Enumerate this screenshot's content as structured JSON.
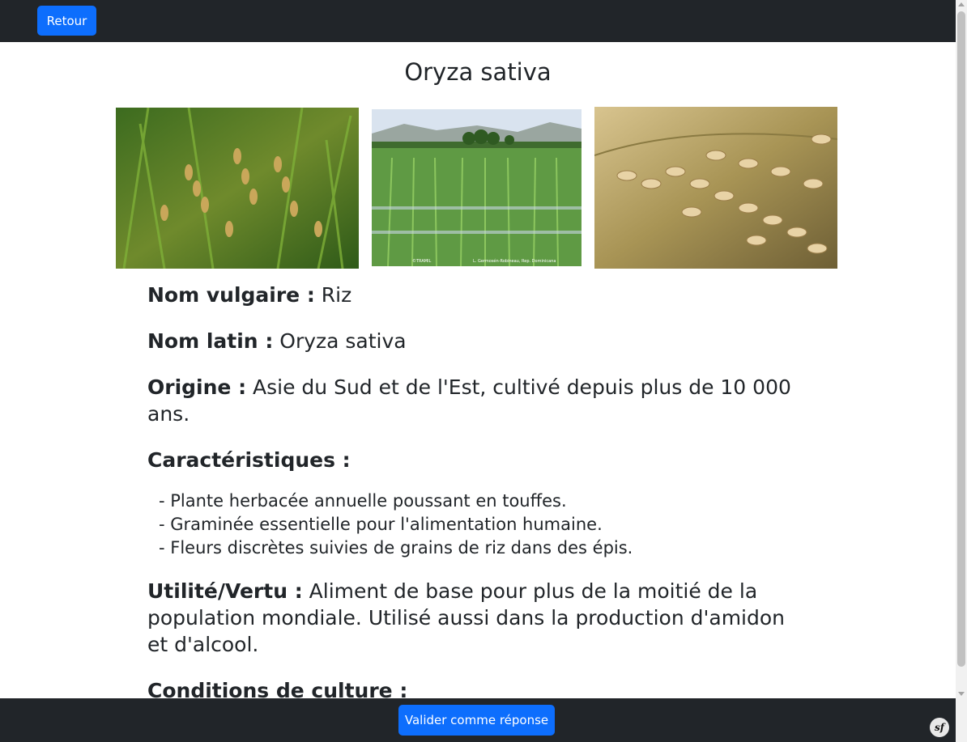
{
  "header": {
    "back_label": "Retour"
  },
  "page": {
    "title": "Oryza sativa"
  },
  "images": [
    {
      "name": "rice-panicles-photo"
    },
    {
      "name": "rice-paddy-photo",
      "credits": [
        "©TRAMIL",
        "L. Germosén-Robineau, Rep. Dominicana"
      ]
    },
    {
      "name": "rice-grains-photo"
    }
  ],
  "details": {
    "common_name": {
      "label": "Nom vulgaire :",
      "value": "Riz"
    },
    "latin_name": {
      "label": "Nom latin :",
      "value": "Oryza sativa"
    },
    "origin": {
      "label": "Origine :",
      "value": "Asie du Sud et de l'Est, cultivé depuis plus de 10 000 ans."
    },
    "characteristics": {
      "label": "Caractéristiques :",
      "items": [
        "- Plante herbacée annuelle poussant en touffes.",
        "- Graminée essentielle pour l'alimentation humaine.",
        "- Fleurs discrètes suivies de grains de riz dans des épis."
      ]
    },
    "utility": {
      "label": "Utilité/Vertu :",
      "value": "Aliment de base pour plus de la moitié de la population mondiale. Utilisé aussi dans la production d'amidon et d'alcool."
    },
    "conditions": {
      "label": "Conditions de culture :"
    }
  },
  "footer": {
    "validate_label": "Valider comme réponse",
    "badge_text": "sf"
  },
  "colors": {
    "bar": "#212529",
    "accent": "#0d6efd"
  }
}
